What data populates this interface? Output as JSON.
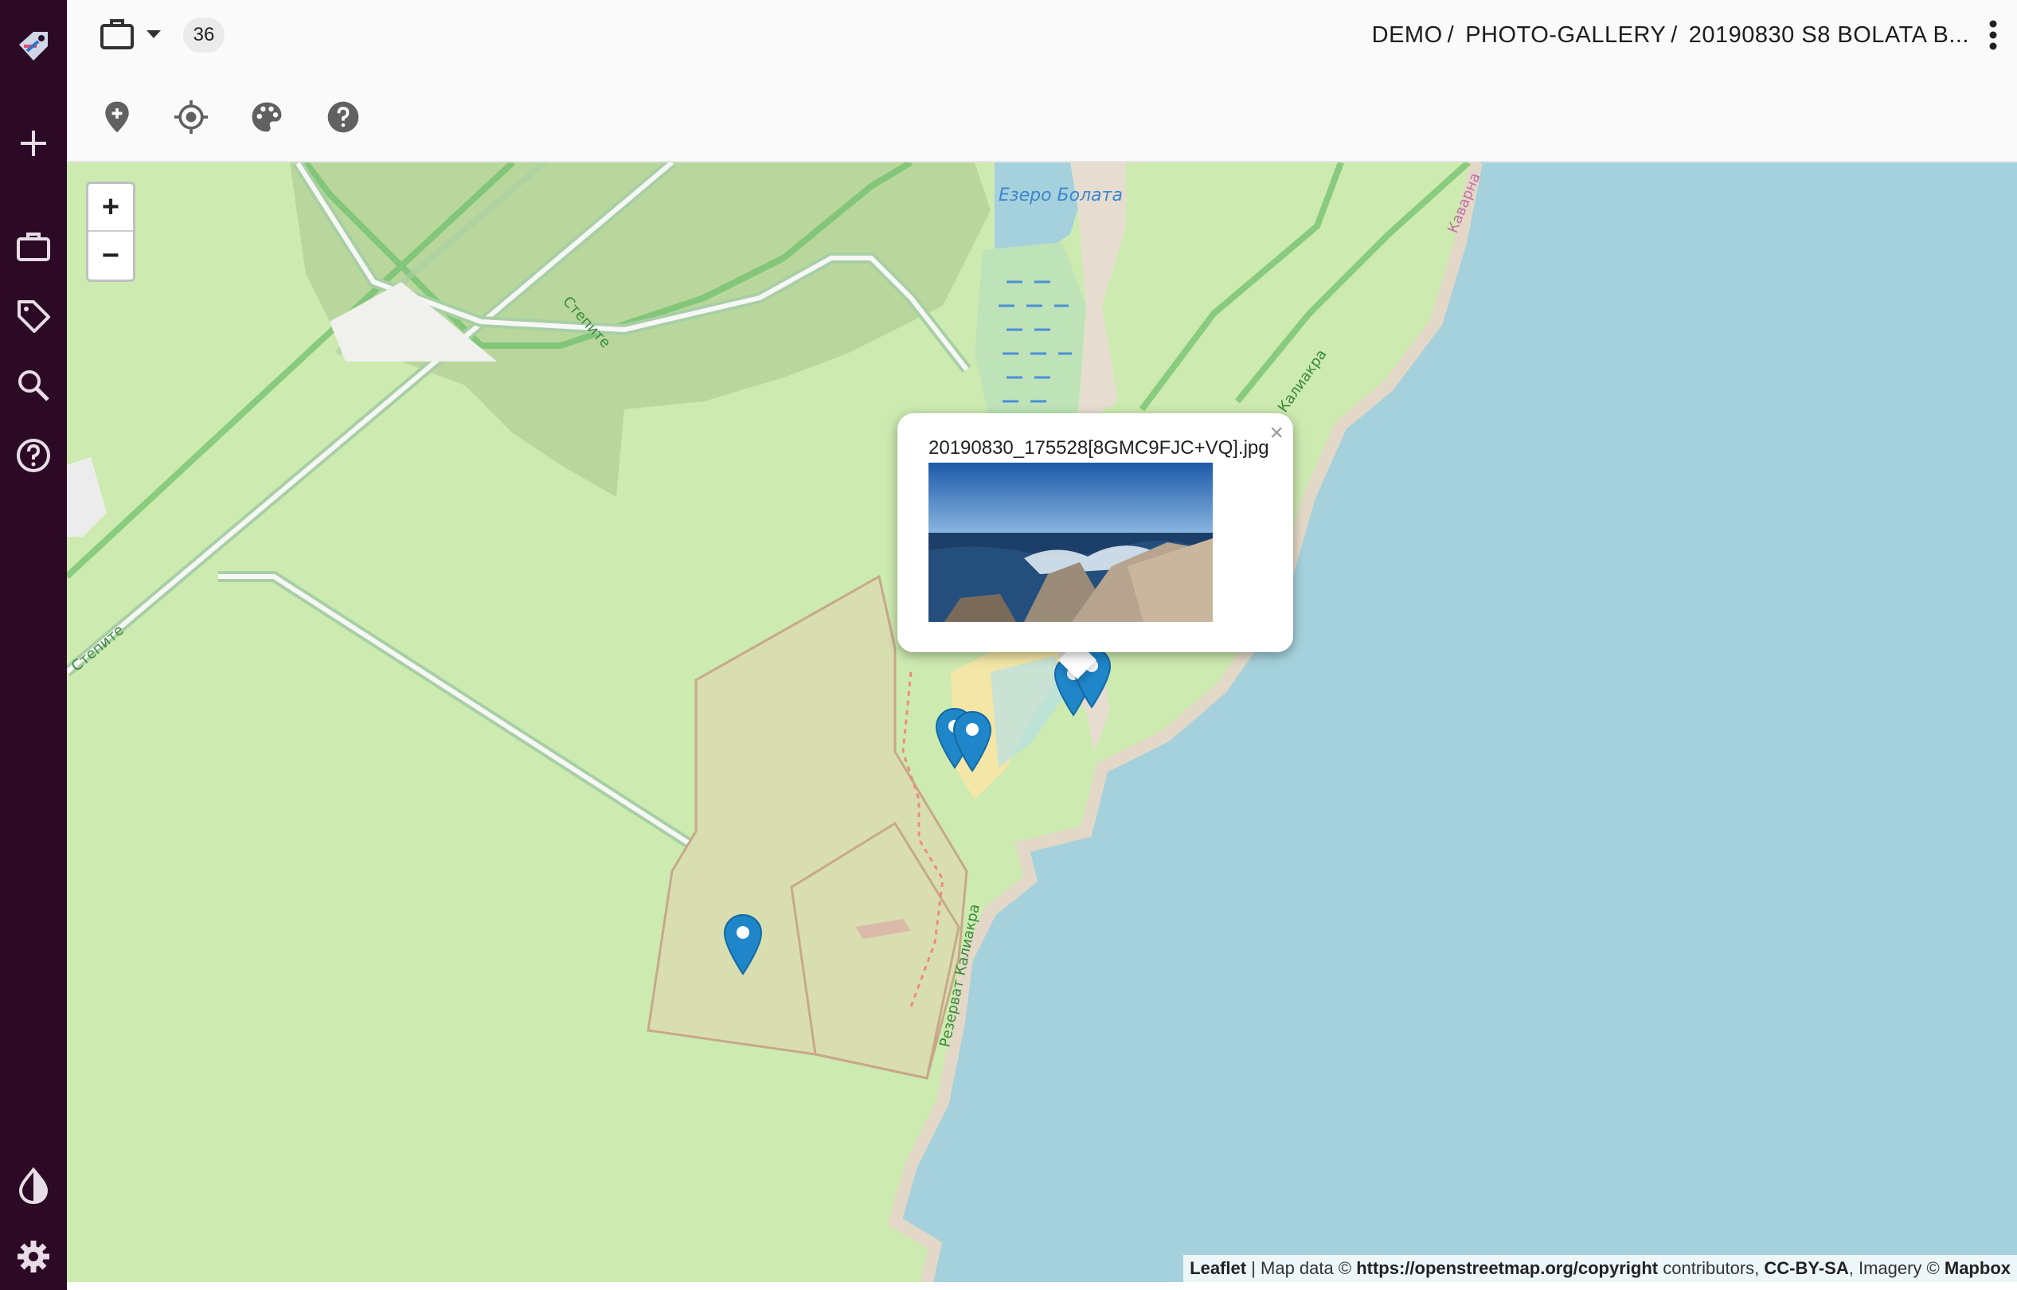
{
  "sidebar": {
    "items": [
      {
        "name": "logo",
        "icon": "app-logo-icon"
      },
      {
        "name": "add",
        "icon": "plus-icon"
      },
      {
        "name": "workspaces",
        "icon": "briefcase-icon"
      },
      {
        "name": "tags",
        "icon": "tag-icon"
      },
      {
        "name": "search",
        "icon": "search-icon"
      },
      {
        "name": "help",
        "icon": "help-circle-icon"
      },
      {
        "name": "theme",
        "icon": "contrast-icon"
      },
      {
        "name": "settings",
        "icon": "gear-icon"
      }
    ],
    "background": "#2c0a26"
  },
  "topbar": {
    "count": "36",
    "breadcrumb": [
      "DEMO",
      "PHOTO-GALLERY",
      "20190830 S8 BOLATA B..."
    ],
    "separator": "/",
    "tools": [
      "add-location-icon",
      "locate-icon",
      "palette-icon",
      "help-icon"
    ]
  },
  "map": {
    "zoom_in": "+",
    "zoom_out": "−",
    "labels": {
      "lake": "Езеро Болата",
      "road1": "Степите",
      "road2": "Степите",
      "cape": "Калиакра",
      "reserve": "Резерват Калиакра",
      "town": "Каварна"
    },
    "popup": {
      "title": "20190830_175528[8GMC9FJC+VQ].jpg",
      "close": "×"
    },
    "attribution": {
      "leaflet": "Leaflet",
      "sep": " | ",
      "map_data": "Map data © ",
      "osm": "https://openstreetmap.org/copyright",
      "contributors": " contributors, ",
      "license": "CC-BY-SA",
      "imagery": ", Imagery © ",
      "mapbox": "Mapbox"
    },
    "colors": {
      "land": "#cdeab0",
      "sea": "#a5d1dc",
      "forest": "#b8d8a0",
      "marker": "#1f86c9"
    }
  }
}
